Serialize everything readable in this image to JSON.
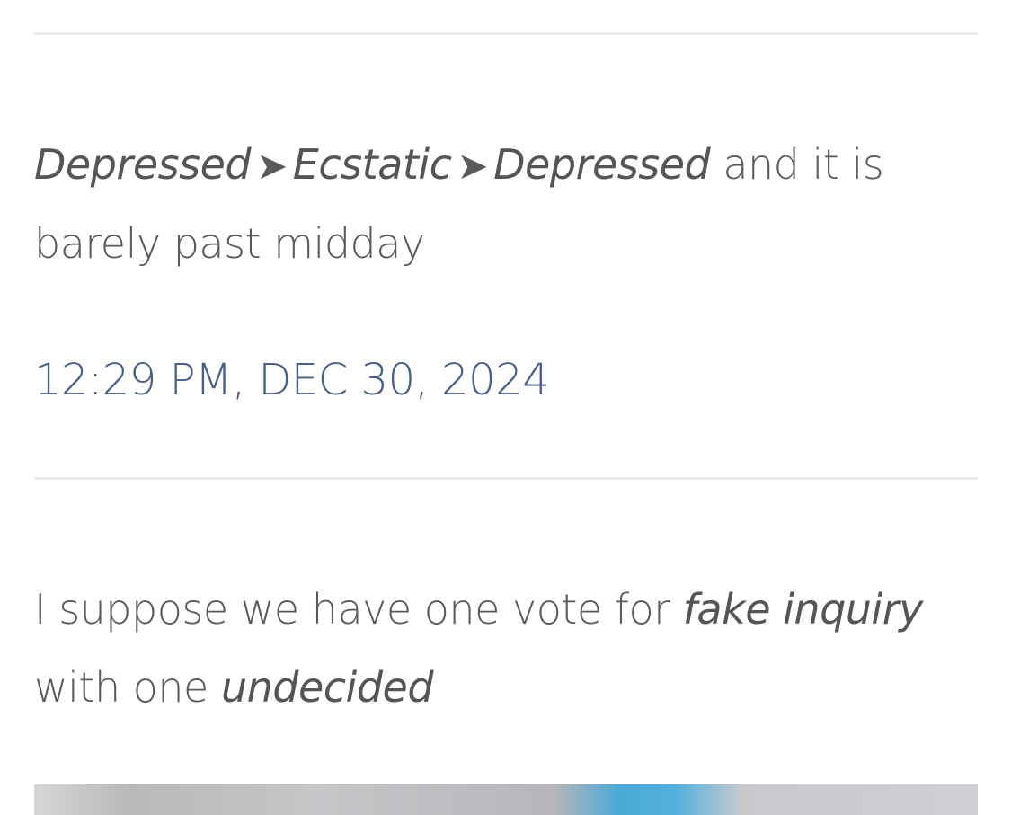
{
  "post1": {
    "mood_a": "Depressed",
    "arrow_1": "➤",
    "mood_b": "Ecstatic",
    "arrow_2": "➤",
    "mood_c": "Depressed",
    "tail": "and it is barely past midday",
    "timestamp": "12:29 PM, DEC 30, 2024"
  },
  "post2": {
    "part_a": "I suppose we have one vote for",
    "em_a": "fake inquiry",
    "part_b": "with one",
    "em_b": "undecided"
  },
  "colors": {
    "text": "#5a5a5a",
    "timestamp": "#4a5f86",
    "divider": "#ebebeb"
  }
}
